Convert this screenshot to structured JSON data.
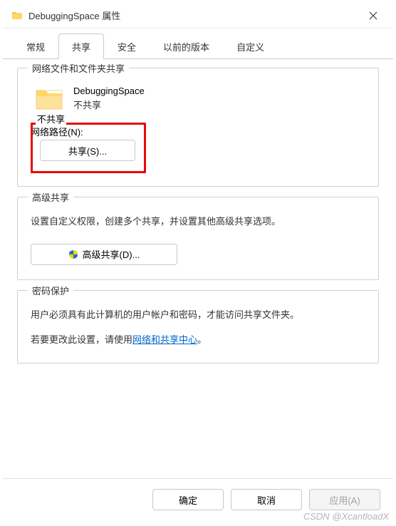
{
  "window": {
    "title": "DebuggingSpace 属性",
    "close_icon": "×"
  },
  "tabs": [
    {
      "label": "常规"
    },
    {
      "label": "共享",
      "active": true
    },
    {
      "label": "安全"
    },
    {
      "label": "以前的版本"
    },
    {
      "label": "自定义"
    }
  ],
  "group_network": {
    "title": "网络文件和文件夹共享",
    "folder_name": "DebuggingSpace",
    "share_status": "不共享",
    "network_path_label": "网络路径(N):",
    "network_path_value": "不共享",
    "share_button": "共享(S)..."
  },
  "group_advanced": {
    "title": "高级共享",
    "description": "设置自定义权限，创建多个共享，并设置其他高级共享选项。",
    "button": "高级共享(D)..."
  },
  "group_password": {
    "title": "密码保护",
    "line1": "用户必须具有此计算机的用户帐户和密码，才能访问共享文件夹。",
    "line2_prefix": "若要更改此设置，请使用",
    "link": "网络和共享中心",
    "line2_suffix": "。"
  },
  "footer": {
    "ok": "确定",
    "cancel": "取消",
    "apply": "应用(A)"
  },
  "watermark": "CSDN @XcantloadX"
}
